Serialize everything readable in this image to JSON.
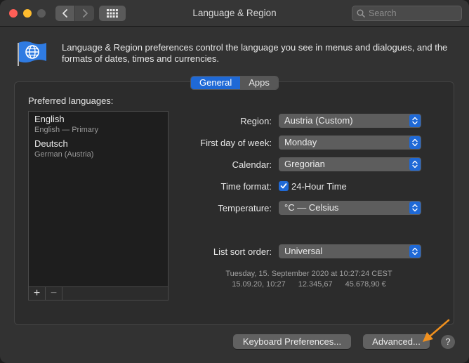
{
  "window": {
    "title": "Language & Region"
  },
  "search": {
    "placeholder": "Search"
  },
  "header": {
    "description": "Language & Region preferences control the language you see in menus and dialogues, and the formats of dates, times and currencies."
  },
  "tabs": [
    {
      "label": "General",
      "active": true
    },
    {
      "label": "Apps",
      "active": false
    }
  ],
  "preferred_languages": {
    "label": "Preferred languages:",
    "items": [
      {
        "name": "English",
        "sub": "English — Primary"
      },
      {
        "name": "Deutsch",
        "sub": "German (Austria)"
      }
    ],
    "add_label": "+",
    "remove_label": "−"
  },
  "settings": {
    "region": {
      "label": "Region:",
      "value": "Austria (Custom)"
    },
    "first_day": {
      "label": "First day of week:",
      "value": "Monday"
    },
    "calendar": {
      "label": "Calendar:",
      "value": "Gregorian"
    },
    "time_format": {
      "label": "Time format:",
      "checkbox_label": "24-Hour Time",
      "checked": true
    },
    "temperature": {
      "label": "Temperature:",
      "value": "°C — Celsius"
    },
    "list_sort": {
      "label": "List sort order:",
      "value": "Universal"
    }
  },
  "sample": {
    "long_date": "Tuesday, 15. September 2020 at 10:27:24 CEST",
    "short_date": "15.09.20, 10:27",
    "number": "12.345,67",
    "currency": "45.678,90 €"
  },
  "buttons": {
    "keyboard": "Keyboard Preferences...",
    "advanced": "Advanced...",
    "help": "?"
  },
  "colors": {
    "accent": "#1f69d6",
    "annotation_arrow": "#f0901e"
  }
}
